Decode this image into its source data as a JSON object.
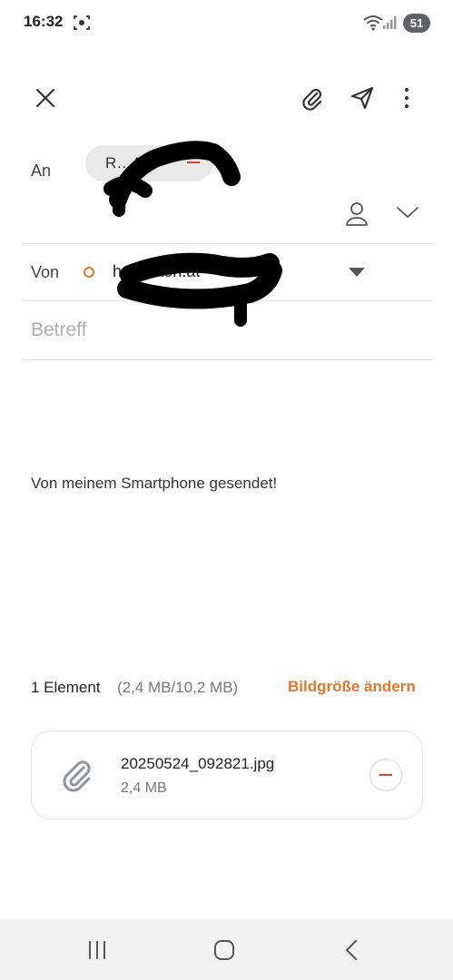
{
  "status_bar": {
    "time": "16:32",
    "battery": "51"
  },
  "toolbar": {
    "close_icon": "close-icon",
    "attach_icon": "paperclip-icon",
    "send_icon": "send-icon",
    "more_icon": "more-vert-icon"
  },
  "to": {
    "label": "An",
    "recipient_chip": "R…A"
  },
  "from": {
    "label": "Von",
    "email": "h…@aon.at"
  },
  "subject": {
    "placeholder": "Betreff"
  },
  "body": {
    "signature": "Von meinem Smartphone gesendet!"
  },
  "attachments": {
    "count_label": "1 Element",
    "size_summary": "(2,4 MB/10,2 MB)",
    "resize_label": "Bildgröße ändern",
    "items": [
      {
        "name": "20250524_092821.jpg",
        "size": "2,4 MB"
      }
    ]
  },
  "colors": {
    "accent": "#e0782f",
    "remove": "#d64a2a"
  }
}
